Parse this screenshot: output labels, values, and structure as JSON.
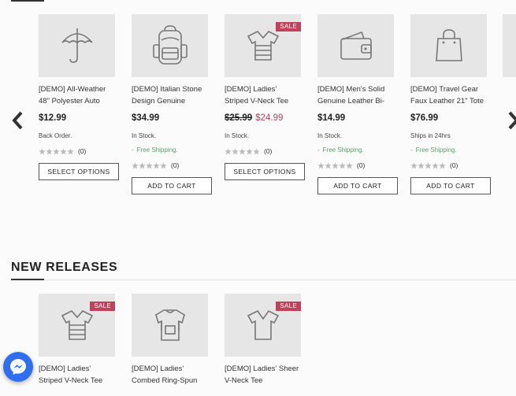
{
  "carousel": {
    "prev_icon": "chevron-left-icon",
    "next_icon": "chevron-right-icon",
    "products": [
      {
        "icon": "umbrella-icon",
        "sale": null,
        "name_line1": "[DEMO] All-Weather",
        "name_line2": "48\" Polyester Auto",
        "price": "$12.99",
        "old_price": null,
        "stock": "Back Order.",
        "shipping": null,
        "rating_count": "(0)",
        "button": "SELECT OPTIONS"
      },
      {
        "icon": "backpack-icon",
        "sale": null,
        "name_line1": "[DEMO] Italian Stone",
        "name_line2": "Design Genuine",
        "price": "$34.99",
        "old_price": null,
        "stock": "In Stock.",
        "shipping": "Free Shipping.",
        "rating_count": "(0)",
        "button": "ADD TO CART"
      },
      {
        "icon": "striped-tshirt-icon",
        "sale": "SALE",
        "name_line1": "[DEMO] Ladies'",
        "name_line2": "Striped V-Neck Tee",
        "price": "$24.99",
        "old_price": "$25.99",
        "stock": "In Stock.",
        "shipping": null,
        "rating_count": "(0)",
        "button": "SELECT OPTIONS"
      },
      {
        "icon": "wallet-icon",
        "sale": null,
        "name_line1": "[DEMO] Men's Solid",
        "name_line2": "Genuine Leather Bi-",
        "price": "$14.99",
        "old_price": null,
        "stock": "In Stock.",
        "shipping": "Free Shipping.",
        "rating_count": "(0)",
        "button": "ADD TO CART"
      },
      {
        "icon": "tote-bag-icon",
        "sale": null,
        "name_line1": "[DEMO] Travel Gear",
        "name_line2": "Faux Leather 21\" Tote",
        "price": "$76.99",
        "old_price": null,
        "stock": "Ships in 24hrs",
        "shipping": "Free Shipping.",
        "rating_count": "(0)",
        "button": "ADD TO CART"
      }
    ]
  },
  "new_releases": {
    "title": "NEW RELEASES",
    "products": [
      {
        "icon": "striped-tshirt-icon",
        "sale": "SALE",
        "name_line1": "[DEMO] Ladies'",
        "name_line2": "Striped V-Neck Tee"
      },
      {
        "icon": "jersey-icon",
        "sale": null,
        "name_line1": "[DEMO] Ladies'",
        "name_line2": "Combed Ring-Spun"
      },
      {
        "icon": "vneck-tshirt-icon",
        "sale": "SALE",
        "name_line1": "[DEMO] Ladies' Sheer",
        "name_line2": "V-Neck Tee"
      }
    ]
  },
  "messenger": {
    "icon": "messenger-icon"
  },
  "colors": {
    "sale": "#c0425a",
    "shipping": "#5aa06b",
    "thumb_bg": "#e6e6e6",
    "messenger": "#2e6ef0"
  }
}
